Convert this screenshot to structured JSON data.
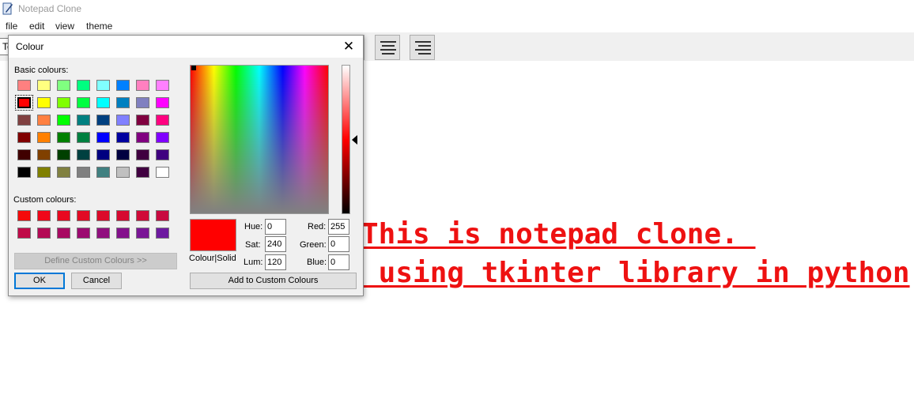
{
  "app": {
    "title": "Notepad Clone"
  },
  "menu": [
    "file",
    "edit",
    "view",
    "theme"
  ],
  "toolbar": {
    "field_text": "Te"
  },
  "editor": {
    "lines": [
      "This is notepad clone. ",
      " using tkinter library in python"
    ],
    "text_color": "#ee1111"
  },
  "dialog": {
    "title": "Colour",
    "basic_label": "Basic colours:",
    "custom_label": "Custom colours:",
    "basic_colours": [
      [
        "#ff8080",
        "#ffff80",
        "#80ff80",
        "#00ff80",
        "#80ffff",
        "#0080ff",
        "#ff80c0",
        "#ff80ff"
      ],
      [
        "#ff0000",
        "#ffff00",
        "#80ff00",
        "#00ff40",
        "#00ffff",
        "#0080c0",
        "#8080c0",
        "#ff00ff"
      ],
      [
        "#804040",
        "#ff8040",
        "#00ff00",
        "#008080",
        "#004080",
        "#8080ff",
        "#800040",
        "#ff0080"
      ],
      [
        "#800000",
        "#ff8000",
        "#008000",
        "#008040",
        "#0000ff",
        "#0000a0",
        "#800080",
        "#8000ff"
      ],
      [
        "#400000",
        "#804000",
        "#004000",
        "#004040",
        "#000080",
        "#000040",
        "#400040",
        "#400080"
      ],
      [
        "#000000",
        "#808000",
        "#808040",
        "#808080",
        "#408080",
        "#c0c0c0",
        "#400040",
        "#ffffff"
      ]
    ],
    "selected_basic": [
      1,
      0
    ],
    "custom_colours": [
      [
        "#f50a0a",
        "#f0071a",
        "#e8081f",
        "#e20a24",
        "#dc0a2a",
        "#d60a30",
        "#d00a38",
        "#c80a40"
      ],
      [
        "#c00a48",
        "#b40a55",
        "#a80a62",
        "#9c0a70",
        "#90107e",
        "#84128c",
        "#7a1696",
        "#6e1aa0"
      ]
    ],
    "define_button": "Define Custom Colours >>",
    "ok_button": "OK",
    "cancel_button": "Cancel",
    "add_button": "Add to Custom Colours",
    "colour_solid_label": "Colour|Solid",
    "current_colour": "#ff0000",
    "hue_label": "Hue:",
    "hue": "0",
    "sat_label": "Sat:",
    "sat": "240",
    "lum_label": "Lum:",
    "lum": "120",
    "red_label": "Red:",
    "red": "255",
    "green_label": "Green:",
    "green": "0",
    "blue_label": "Blue:",
    "blue": "0"
  }
}
